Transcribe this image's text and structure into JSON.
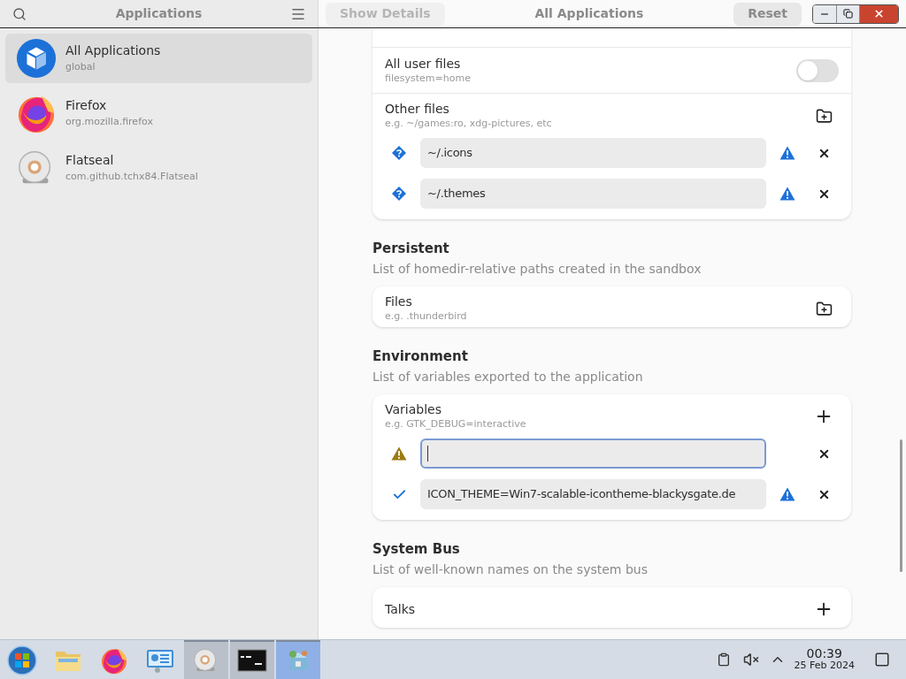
{
  "sidebar": {
    "title": "Applications",
    "items": [
      {
        "name": "All Applications",
        "id": "global",
        "kind": "box",
        "selected": true
      },
      {
        "name": "Firefox",
        "id": "org.mozilla.firefox",
        "kind": "firefox",
        "selected": false
      },
      {
        "name": "Flatseal",
        "id": "com.github.tchx84.Flatseal",
        "kind": "flatseal",
        "selected": false
      }
    ]
  },
  "header": {
    "details_button": "Show Details",
    "title": "All Applications",
    "reset_button": "Reset"
  },
  "top_card": {
    "rows": [
      {
        "kind": "toggle",
        "label": "All user files",
        "hint": "filesystem=home",
        "on": false
      },
      {
        "kind": "folder",
        "label": "Other files",
        "hint": "e.g. ~/games:ro, xdg-pictures, etc",
        "entries": [
          {
            "value": "~/.icons",
            "kind": "unknown",
            "warning": true,
            "focused": false
          },
          {
            "value": "~/.themes",
            "kind": "unknown",
            "warning": true,
            "focused": false
          }
        ]
      }
    ]
  },
  "sections": [
    {
      "title": "Persistent",
      "description": "List of homedir-relative paths created in the sandbox",
      "label": "Files",
      "hint": "e.g. .thunderbird",
      "kind": "folder"
    },
    {
      "title": "Environment",
      "description": "List of variables exported to the application",
      "label": "Variables",
      "hint": "e.g. GTK_DEBUG=interactive",
      "kind": "add",
      "entries": [
        {
          "kind": "invalid",
          "warning": false,
          "focused": true
        },
        {
          "value": "ICON_THEME=Win7-scalable-icontheme-blackysgate.de",
          "kind": "valid",
          "warning": true,
          "focused": false
        }
      ]
    },
    {
      "title": "System Bus",
      "description": "List of well-known names on the system bus",
      "label": "Talks",
      "kind": "add"
    }
  ],
  "taskbar": {
    "apps": [
      {
        "kind": "start",
        "open": false,
        "selected": false
      },
      {
        "kind": "files",
        "open": false,
        "selected": false
      },
      {
        "kind": "firefox",
        "open": false,
        "selected": false
      },
      {
        "kind": "control",
        "open": false,
        "selected": false
      },
      {
        "kind": "flatseal",
        "open": true,
        "selected": false
      },
      {
        "kind": "terminal",
        "open": true,
        "selected": false
      },
      {
        "kind": "package",
        "open": true,
        "selected": true
      }
    ],
    "time": "00:39",
    "date": "25 Feb 2024"
  }
}
